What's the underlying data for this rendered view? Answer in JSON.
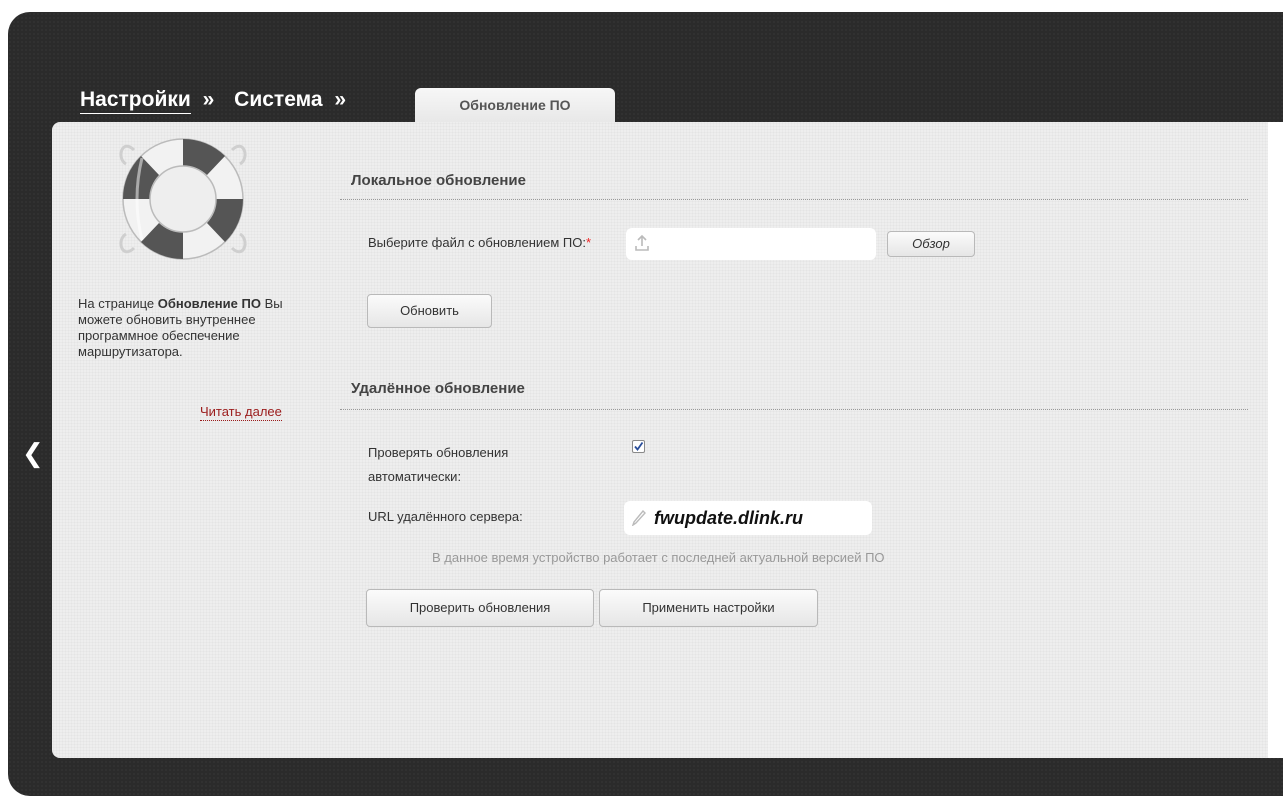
{
  "breadcrumbs": {
    "item1": "Настройки",
    "item2": "Система",
    "separator": "»"
  },
  "active_tab": "Обновление ПО",
  "sidebar": {
    "help_prefix": "На странице ",
    "help_bold": "Обновление ПО",
    "help_suffix": " Вы можете обновить внутреннее программное обеспечение маршрутизатора.",
    "read_more": "Читать далее",
    "icon": "lifebuoy-icon"
  },
  "local_update": {
    "title": "Локальное обновление",
    "file_label": "Выберите файл с обновлением ПО:",
    "required_mark": "*",
    "browse_button": "Обзор",
    "update_button": "Обновить"
  },
  "remote_update": {
    "title": "Удалённое обновление",
    "auto_check_label": "Проверять обновления автоматически:",
    "auto_check_checked": true,
    "url_label": "URL удалённого сервера:",
    "url_value": "fwupdate.dlink.ru",
    "status_message": "В данное время устройство работает с последней актуальной версией ПО",
    "check_button": "Проверить обновления",
    "apply_button": "Применить настройки"
  },
  "colors": {
    "frame": "#2b2b2b",
    "panel": "#eeeeee",
    "link": "#9b1b1b",
    "required": "#ee2222"
  }
}
